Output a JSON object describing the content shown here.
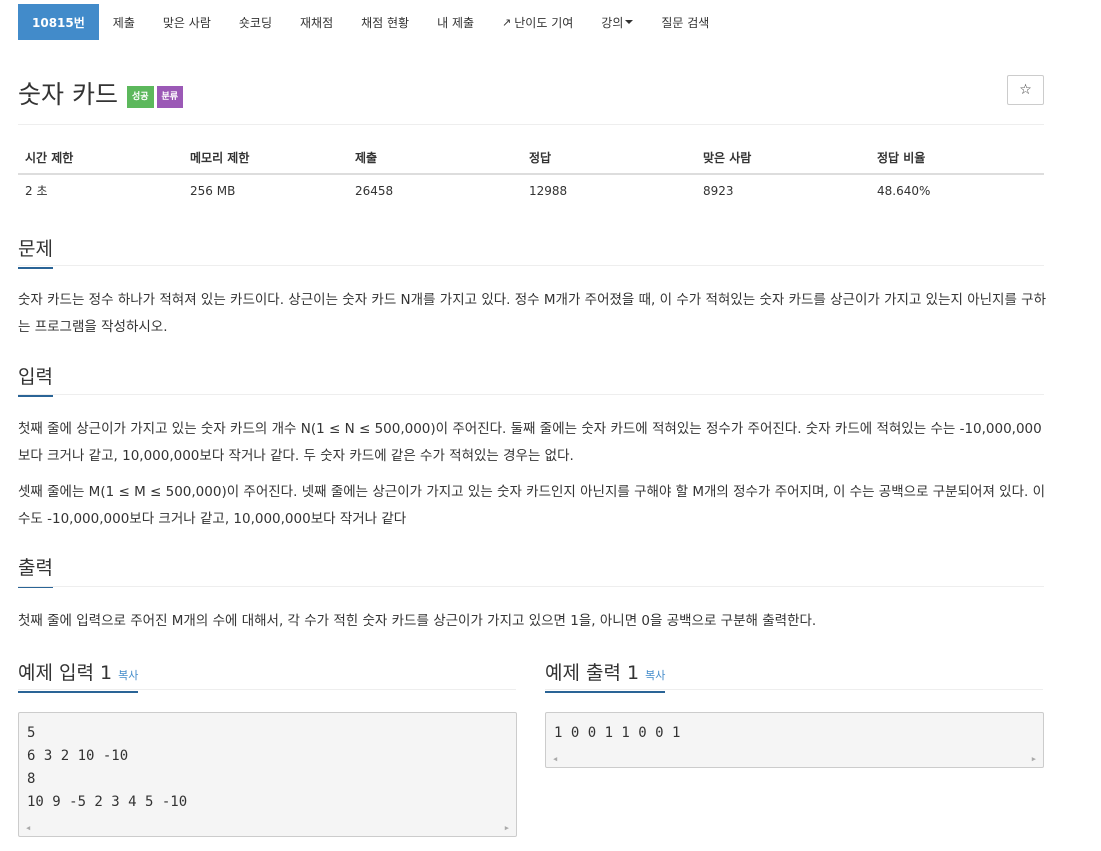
{
  "nav": {
    "tabs": [
      {
        "label": "10815번",
        "active": true
      },
      {
        "label": "제출"
      },
      {
        "label": "맞은 사람"
      },
      {
        "label": "숏코딩"
      },
      {
        "label": "재채점"
      },
      {
        "label": "채점 현황"
      },
      {
        "label": "내 제출"
      },
      {
        "label": "난이도 기여",
        "icon": "external-link-icon"
      },
      {
        "label": "강의",
        "icon": "caret-down-icon"
      },
      {
        "label": "질문 검색"
      }
    ]
  },
  "problem": {
    "title": "숫자 카드",
    "badges": {
      "success": "성공",
      "category": "분류"
    },
    "star_icon": "☆"
  },
  "info_table": {
    "headers": [
      "시간 제한",
      "메모리 제한",
      "제출",
      "정답",
      "맞은 사람",
      "정답 비율"
    ],
    "values": [
      "2 초",
      "256 MB",
      "26458",
      "12988",
      "8923",
      "48.640%"
    ]
  },
  "sections": {
    "description": {
      "title": "문제",
      "text": "숫자 카드는 정수 하나가 적혀져 있는 카드이다. 상근이는 숫자 카드 N개를 가지고 있다. 정수 M개가 주어졌을 때, 이 수가 적혀있는 숫자 카드를 상근이가 가지고 있는지 아닌지를 구하는 프로그램을 작성하시오."
    },
    "input": {
      "title": "입력",
      "paragraph1": "첫째 줄에 상근이가 가지고 있는 숫자 카드의 개수 N(1 ≤ N ≤ 500,000)이 주어진다. 둘째 줄에는 숫자 카드에 적혀있는 정수가 주어진다. 숫자 카드에 적혀있는 수는 -10,000,000보다 크거나 같고, 10,000,000보다 작거나 같다. 두 숫자 카드에 같은 수가 적혀있는 경우는 없다.",
      "paragraph2": "셋째 줄에는 M(1 ≤ M ≤ 500,000)이 주어진다. 넷째 줄에는 상근이가 가지고 있는 숫자 카드인지 아닌지를 구해야 할 M개의 정수가 주어지며, 이 수는 공백으로 구분되어져 있다. 이 수도 -10,000,000보다 크거나 같고, 10,000,000보다 작거나 같다"
    },
    "output": {
      "title": "출력",
      "text": "첫째 줄에 입력으로 주어진 M개의 수에 대해서, 각 수가 적힌 숫자 카드를 상근이가 가지고 있으면 1을, 아니면 0을 공백으로 구분해 출력한다."
    }
  },
  "samples": {
    "input": {
      "title": "예제 입력 1",
      "copy_label": "복사",
      "lines": [
        "5",
        "6 3 2 10 -10",
        "8",
        "10 9 -5 2 3 4 5 -10"
      ]
    },
    "output": {
      "title": "예제 출력 1",
      "copy_label": "복사",
      "lines": [
        "1 0 0 1 1 0 0 1"
      ]
    }
  }
}
